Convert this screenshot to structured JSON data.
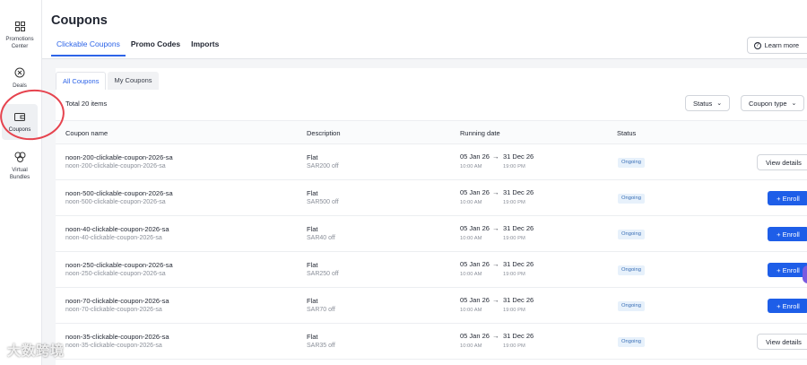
{
  "sidebar": {
    "items": [
      {
        "label": "Promotions Center",
        "icon": "grid-icon"
      },
      {
        "label": "Deals",
        "icon": "percent-circle-icon"
      },
      {
        "label": "Coupons",
        "icon": "wallet-icon",
        "active": true
      },
      {
        "label": "Virtual Bundles",
        "icon": "bundle-icon"
      }
    ]
  },
  "header": {
    "title": "Coupons",
    "tabs": [
      {
        "label": "Clickable Coupons",
        "active": true
      },
      {
        "label": "Promo Codes"
      },
      {
        "label": "Imports"
      }
    ],
    "learn_more": "Learn more"
  },
  "subtabs": [
    {
      "label": "All Coupons",
      "active": true
    },
    {
      "label": "My Coupons"
    }
  ],
  "total_label": "Total 20 items",
  "filters": {
    "status": "Status",
    "coupon_type": "Coupon type"
  },
  "table": {
    "columns": [
      "Coupon name",
      "Description",
      "Running date",
      "Status"
    ],
    "rows": [
      {
        "name": "noon-200-clickable-coupon-2026-sa",
        "sub": "noon-200-clickable-coupon-2026-sa",
        "desc": "Flat",
        "desc_sub": "SAR200 off",
        "start": "05 Jan 26",
        "end": "31 Dec 26",
        "start_time": "10:00 AM",
        "end_time": "19:00 PM",
        "status": "Ongoing",
        "action": "View details",
        "action_type": "view"
      },
      {
        "name": "noon-500-clickable-coupon-2026-sa",
        "sub": "noon-500-clickable-coupon-2026-sa",
        "desc": "Flat",
        "desc_sub": "SAR500 off",
        "start": "05 Jan 26",
        "end": "31 Dec 26",
        "start_time": "10:00 AM",
        "end_time": "19:00 PM",
        "status": "Ongoing",
        "action": "+ Enroll",
        "action_type": "enroll"
      },
      {
        "name": "noon-40-clickable-coupon-2026-sa",
        "sub": "noon-40-clickable-coupon-2026-sa",
        "desc": "Flat",
        "desc_sub": "SAR40 off",
        "start": "05 Jan 26",
        "end": "31 Dec 26",
        "start_time": "10:00 AM",
        "end_time": "19:00 PM",
        "status": "Ongoing",
        "action": "+ Enroll",
        "action_type": "enroll"
      },
      {
        "name": "noon-250-clickable-coupon-2026-sa",
        "sub": "noon-250-clickable-coupon-2026-sa",
        "desc": "Flat",
        "desc_sub": "SAR250 off",
        "start": "05 Jan 26",
        "end": "31 Dec 26",
        "start_time": "10:00 AM",
        "end_time": "19:00 PM",
        "status": "Ongoing",
        "action": "+ Enroll",
        "action_type": "enroll"
      },
      {
        "name": "noon-70-clickable-coupon-2026-sa",
        "sub": "noon-70-clickable-coupon-2026-sa",
        "desc": "Flat",
        "desc_sub": "SAR70 off",
        "start": "05 Jan 26",
        "end": "31 Dec 26",
        "start_time": "10:00 AM",
        "end_time": "19:00 PM",
        "status": "Ongoing",
        "action": "+ Enroll",
        "action_type": "enroll"
      },
      {
        "name": "noon-35-clickable-coupon-2026-sa",
        "sub": "noon-35-clickable-coupon-2026-sa",
        "desc": "Flat",
        "desc_sub": "SAR35 off",
        "start": "05 Jan 26",
        "end": "31 Dec 26",
        "start_time": "10:00 AM",
        "end_time": "19:00 PM",
        "status": "Ongoing",
        "action": "View details",
        "action_type": "view"
      }
    ]
  },
  "watermark": "大数跨境",
  "colors": {
    "accent": "#1e5ee8",
    "annotation": "#e6434e",
    "badge_bg": "#e7f1fb"
  }
}
